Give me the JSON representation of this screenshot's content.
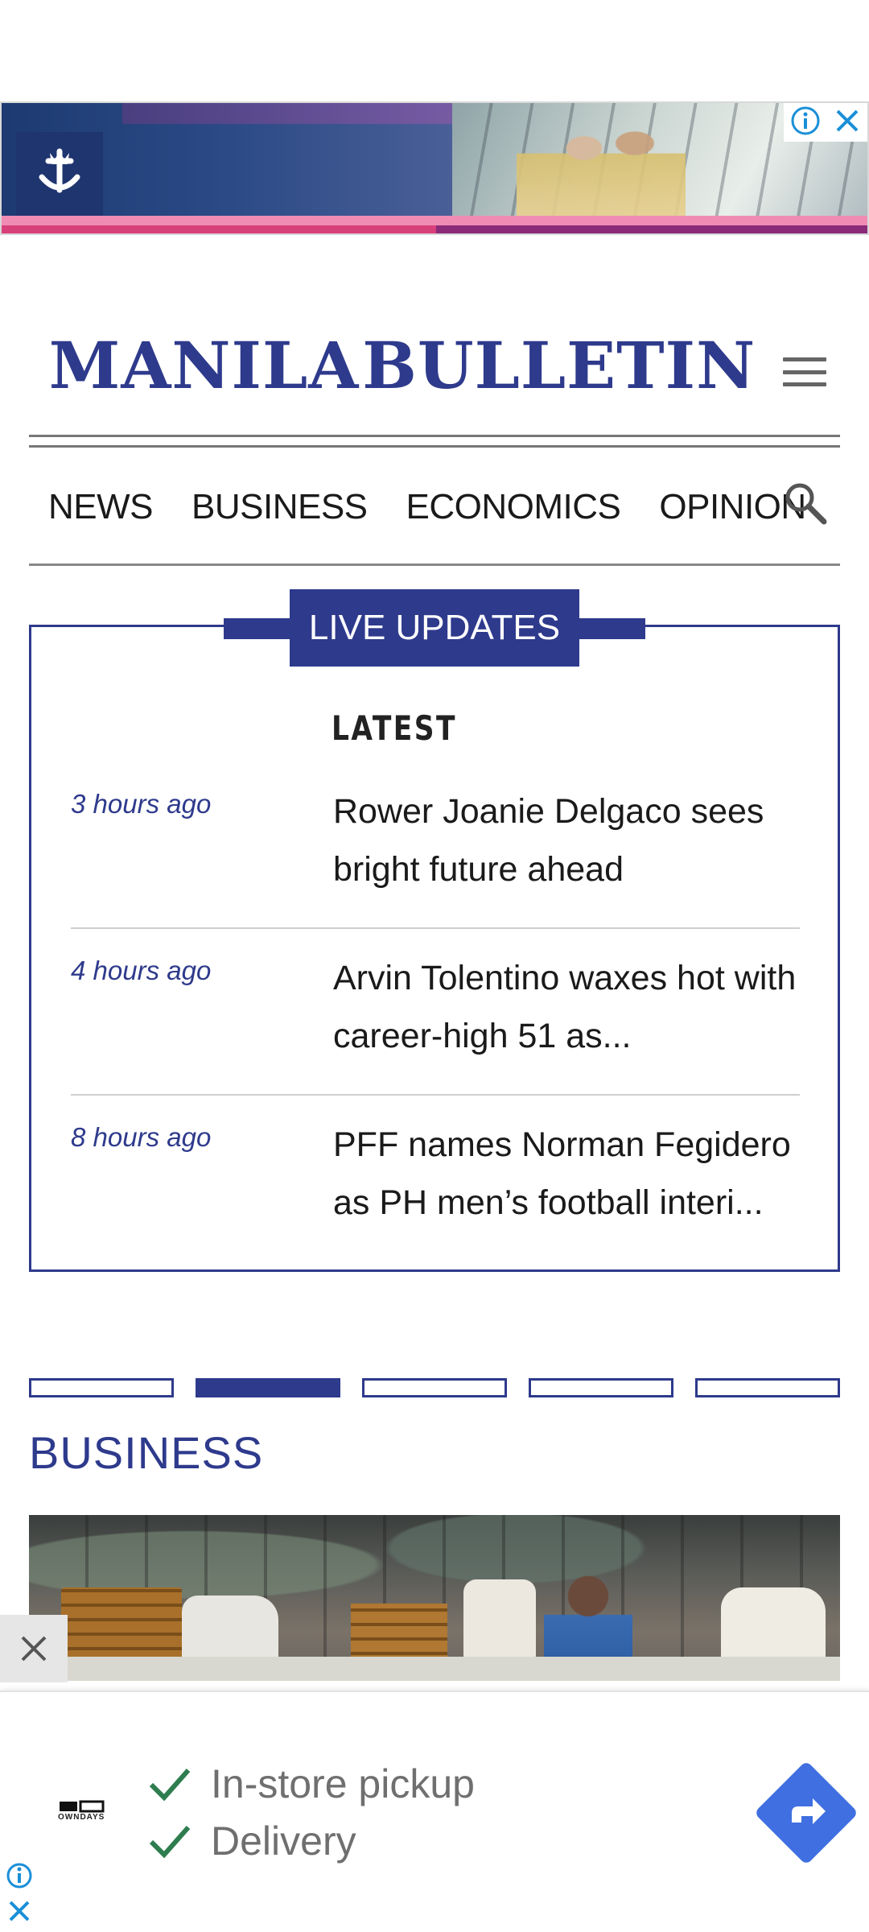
{
  "ads": {
    "top_banner": {
      "brand_icon": "crown-anchor-logo-icon",
      "info_icon": "info-icon",
      "close_icon": "close-icon"
    },
    "bottom_banner": {
      "brand_icon": "owndays-logo-icon",
      "brand_name": "OWNDAYS",
      "lines": [
        {
          "text": "In-store pickup"
        },
        {
          "text": "Delivery"
        }
      ],
      "action_icon": "directions-arrow-icon",
      "info_icon": "info-icon",
      "close_icon": "close-icon",
      "accent_color": "#3f6fe0",
      "check_color": "#2e7d4f"
    }
  },
  "header": {
    "logo_left": "MANILA",
    "logo_right": "BULLETIN",
    "brand_color": "#2e3a8c",
    "menu_icon": "hamburger-menu-icon"
  },
  "nav": {
    "items": [
      {
        "label": "NEWS"
      },
      {
        "label": "BUSINESS"
      },
      {
        "label": "ECONOMICS"
      },
      {
        "label": "OPINION"
      }
    ],
    "search_icon": "search-icon"
  },
  "live": {
    "tab_label": "LIVE UPDATES",
    "section_label": "LATEST",
    "items": [
      {
        "time": "3 hours ago",
        "title": "Rower Joanie Delgaco sees bright future ahead"
      },
      {
        "time": "4 hours ago",
        "title": "Arvin Tolentino waxes hot with career-high 51 as..."
      },
      {
        "time": "8 hours ago",
        "title": "PFF names Norman Fegidero as PH men’s football interi..."
      }
    ]
  },
  "carousel": {
    "count": 5,
    "active_index": 1
  },
  "section": {
    "title": "BUSINESS"
  },
  "side_close_icon": "close-icon"
}
